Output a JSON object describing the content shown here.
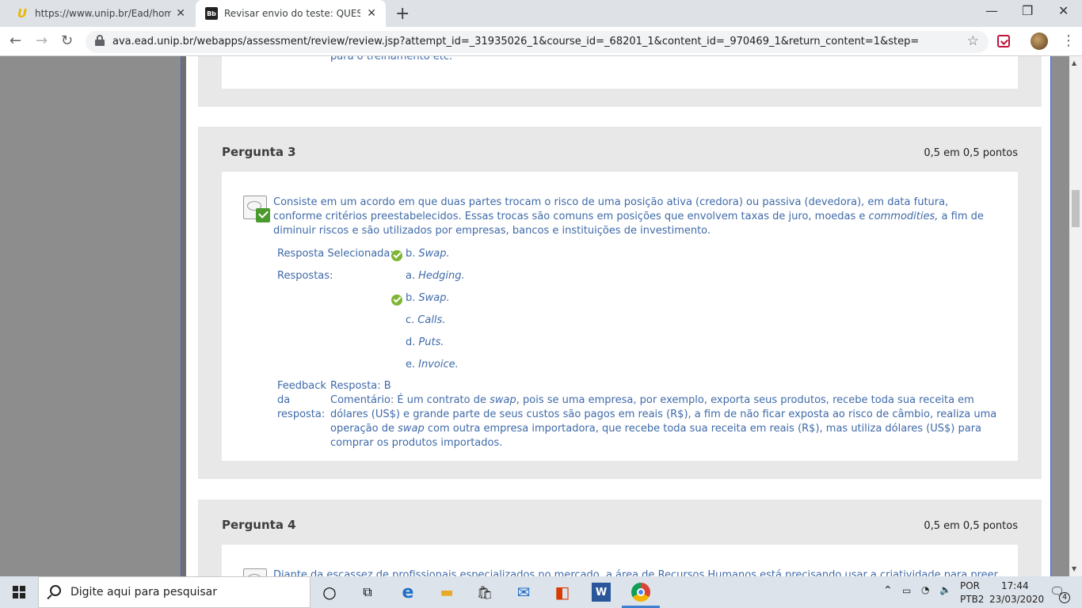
{
  "browser": {
    "tabs": [
      {
        "title": "https://www.unip.br/Ead/home/lo",
        "favicon": "unip-icon",
        "active": false
      },
      {
        "title": "Revisar envio do teste: QUESTION",
        "favicon": "blackboard-icon",
        "favicon_text": "Bb",
        "active": true
      }
    ],
    "url": "ava.ead.unip.br/webapps/assessment/review/review.jsp?attempt_id=_31935026_1&course_id=_68201_1&content_id=_970469_1&return_content=1&step="
  },
  "previous": {
    "tail_text": "para o treinamento etc."
  },
  "question3": {
    "title": "Pergunta 3",
    "points": "0,5 em 0,5 pontos",
    "text_part1": "Consiste em um acordo em que duas partes trocam o risco de uma posição ativa (credora) ou passiva (devedora), em data futura, conforme critérios preestabelecidos. Essas trocas são comuns em posições que envolvem taxas de juro, moedas e ",
    "text_italic": "commodities,",
    "text_part2": " a fim de diminuir riscos e são utilizados por empresas, bancos e instituições de investimento.",
    "selected_label": "Resposta Selecionada:",
    "selected_letter": "b.",
    "selected_text": "Swap.",
    "answers_label": "Respostas:",
    "answers": [
      {
        "letter": "a.",
        "text": "Hedging.",
        "correct": false
      },
      {
        "letter": "b.",
        "text": "Swap.",
        "correct": true
      },
      {
        "letter": "c.",
        "text": "Calls.",
        "correct": false
      },
      {
        "letter": "d.",
        "text": "Puts.",
        "correct": false
      },
      {
        "letter": "e.",
        "text": "Invoice.",
        "correct": false
      }
    ],
    "feedback_label_1": "Feedback",
    "feedback_label_2": "da",
    "feedback_label_3": "resposta:",
    "feedback_answer": "Resposta: B",
    "feedback_c1": "Comentário: É um contrato de ",
    "feedback_c2": "swap",
    "feedback_c3": ", pois se uma empresa, por exemplo, exporta seus produtos, recebe toda sua receita em dólares (US$) e grande parte de seus custos são pagos em reais (R$), a fim de não ficar exposta ao risco de câmbio, realiza uma operação de ",
    "feedback_c4": "swap",
    "feedback_c5": " com outra empresa importadora, que recebe toda sua receita em reais (R$), mas utiliza dólares (US$) para comprar os produtos importados."
  },
  "question4": {
    "title": "Pergunta 4",
    "points": "0,5 em 0,5 pontos",
    "text_start": "Diante da escassez de profissionais especializados no mercado, a área de Recursos Humanos está precisando usar a criatividade para preencher"
  },
  "taskbar": {
    "search_placeholder": "Digite aqui para pesquisar",
    "lang_1": "POR",
    "lang_2": "PTB2",
    "time": "17:44",
    "date": "23/03/2020",
    "notifications": "4"
  }
}
